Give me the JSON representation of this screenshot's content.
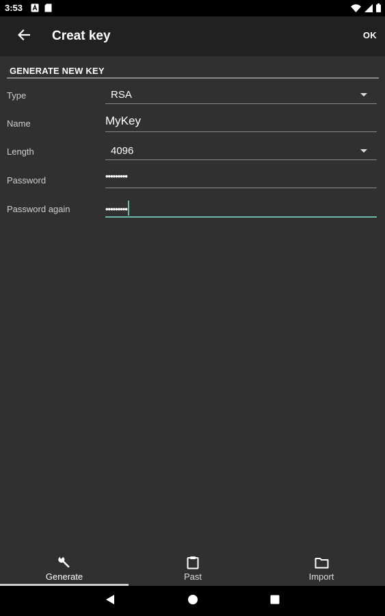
{
  "status_bar": {
    "time": "3:53",
    "left_icons": [
      "notification-a-icon",
      "sd-card-icon"
    ],
    "right_icons": [
      "wifi-icon",
      "cell-signal-icon",
      "battery-icon"
    ]
  },
  "app_bar": {
    "title": "Creat key",
    "action_label": "OK",
    "back_icon": "arrow-back-icon"
  },
  "section": {
    "title": "GENERATE NEW KEY"
  },
  "form": {
    "type": {
      "label": "Type",
      "value": "RSA"
    },
    "name": {
      "label": "Name",
      "value": "MyKey"
    },
    "length": {
      "label": "Length",
      "value": "4096"
    },
    "password": {
      "label": "Password",
      "value": "•••••••••"
    },
    "password_again": {
      "label": "Password again",
      "value": "•••••••••"
    }
  },
  "bottom_nav": {
    "items": [
      {
        "label": "Generate",
        "icon": "wrench-icon",
        "selected": true
      },
      {
        "label": "Past",
        "icon": "clipboard-icon",
        "selected": false
      },
      {
        "label": "Import",
        "icon": "folder-icon",
        "selected": false
      }
    ]
  },
  "system_nav": [
    "back-triangle-icon",
    "home-circle-icon",
    "recents-square-icon"
  ],
  "colors": {
    "background": "#303030",
    "app_bar": "#212121",
    "accent": "#6fb6ad",
    "status_bar": "#000000"
  }
}
